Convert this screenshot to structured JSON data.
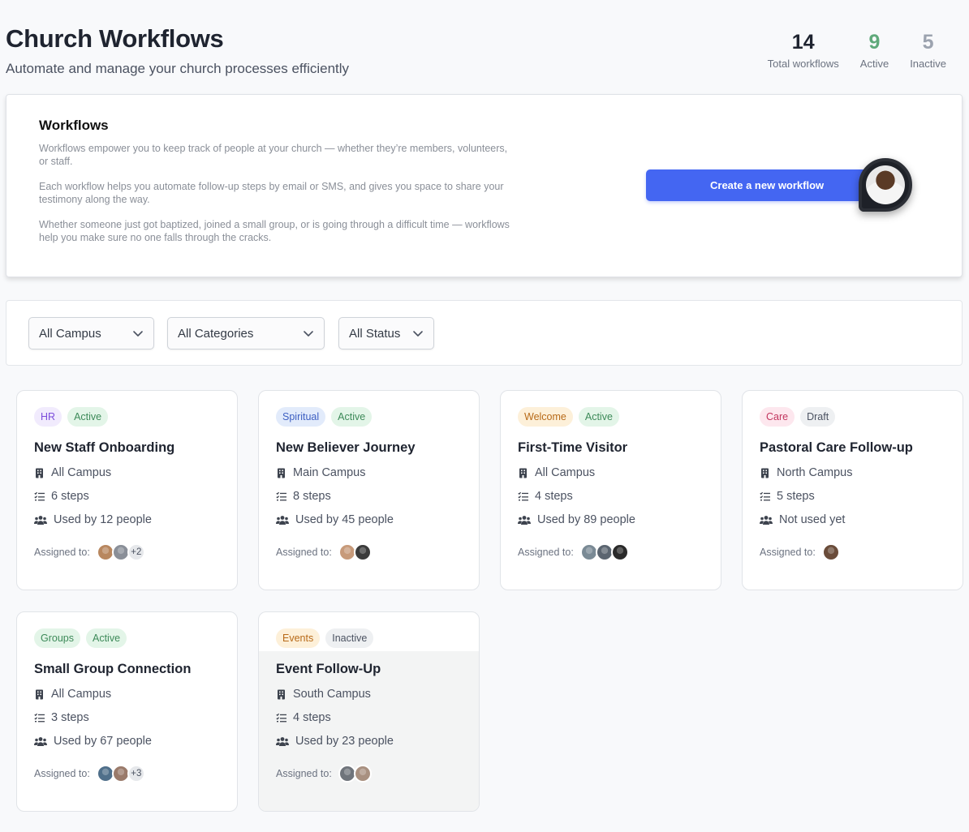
{
  "header": {
    "title": "Church Workflows",
    "subtitle": "Automate and manage your church processes efficiently"
  },
  "stats": [
    {
      "value": "14",
      "label": "Total workflows",
      "kind": "total"
    },
    {
      "value": "9",
      "label": "Active",
      "kind": "active"
    },
    {
      "value": "5",
      "label": "Inactive",
      "kind": "inactive"
    }
  ],
  "intro": {
    "heading": "Workflows",
    "paragraphs": [
      "Workflows empower you to keep track of people at your church — whether they’re members, volunteers, or staff.",
      "Each workflow helps you automate follow-up steps by email or SMS, and gives you space to share your testimony along the way.",
      "Whether someone just got baptized, joined a small group, or is going through a difficult time — workflows help you make sure no one falls through the cracks."
    ],
    "create_button": "Create a new workflow"
  },
  "filters": {
    "campus": "All Campus",
    "categories": "All Categories",
    "status": "All Status"
  },
  "colors": {
    "primary": "#4466f2",
    "active_green": "#5fa97a"
  },
  "assigned_label": "Assigned to:",
  "workflows": [
    {
      "category": "HR",
      "category_bg": "#f1ebfd",
      "category_fg": "#7c4ddb",
      "status": "Active",
      "status_bg": "#e3f5e8",
      "status_fg": "#3d8a59",
      "title": "New Staff Onboarding",
      "campus": "All Campus",
      "steps": "6 steps",
      "usage": "Used by 12 people",
      "avatars": [
        "#b8875f",
        "#8a8f98"
      ],
      "more": "+2"
    },
    {
      "category": "Spiritual",
      "category_bg": "#e2ebfb",
      "category_fg": "#3d5fc2",
      "status": "Active",
      "status_bg": "#e3f5e8",
      "status_fg": "#3d8a59",
      "title": "New Believer Journey",
      "campus": "Main Campus",
      "steps": "8 steps",
      "usage": "Used by 45 people",
      "avatars": [
        "#c79a7a",
        "#3b3b3b"
      ],
      "more": ""
    },
    {
      "category": "Welcome",
      "category_bg": "#fdf0d9",
      "category_fg": "#b86a18",
      "status": "Active",
      "status_bg": "#e3f5e8",
      "status_fg": "#3d8a59",
      "title": "First-Time Visitor",
      "campus": "All Campus",
      "steps": "4 steps",
      "usage": "Used by 89 people",
      "avatars": [
        "#7a8a95",
        "#5b6570",
        "#2a2a2a"
      ],
      "more": ""
    },
    {
      "category": "Care",
      "category_bg": "#fde7ee",
      "category_fg": "#c2365f",
      "status": "Draft",
      "status_bg": "#eef0f2",
      "status_fg": "#4b5261",
      "title": "Pastoral Care Follow-up",
      "campus": "North Campus",
      "steps": "5 steps",
      "usage": "Not used yet",
      "avatars": [
        "#6a4c3a"
      ],
      "more": ""
    },
    {
      "category": "Groups",
      "category_bg": "#e3f5e8",
      "category_fg": "#3d8a59",
      "status": "Active",
      "status_bg": "#e3f5e8",
      "status_fg": "#3d8a59",
      "title": "Small Group Connection",
      "campus": "All Campus",
      "steps": "3 steps",
      "usage": "Used by 67 people",
      "avatars": [
        "#4f6f8a",
        "#9a7a6a"
      ],
      "more": "+3"
    },
    {
      "category": "Events",
      "category_bg": "#fdf0d9",
      "category_fg": "#b86a18",
      "status": "Inactive",
      "status_bg": "#eef0f2",
      "status_fg": "#4b5261",
      "title": "Event Follow-Up",
      "campus": "South Campus",
      "steps": "4 steps",
      "usage": "Used by 23 people",
      "avatars": [
        "#6f747b",
        "#a89080"
      ],
      "more": ""
    }
  ]
}
